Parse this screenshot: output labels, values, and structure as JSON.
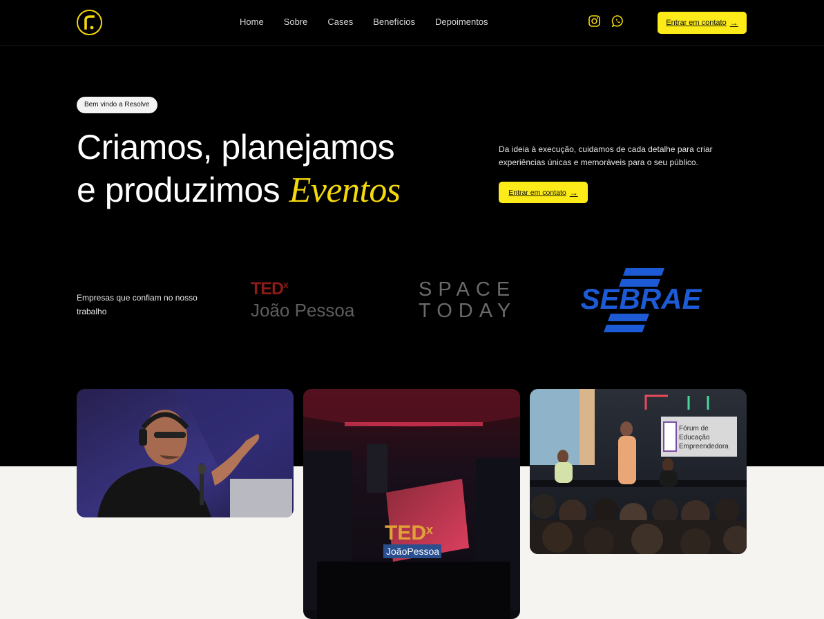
{
  "nav": {
    "items": [
      "Home",
      "Sobre",
      "Cases",
      "Benefícios",
      "Depoimentos"
    ]
  },
  "header": {
    "cta_label": "Entrar em contato",
    "social_icons": [
      "instagram-icon",
      "whatsapp-icon"
    ]
  },
  "hero": {
    "badge": "Bem vindo a Resolve",
    "title_line1": "Criamos, planejamos",
    "title_line2_start": "e produzimos",
    "title_accent": "Eventos",
    "description": "Da ideia à execução, cuidamos de cada detalhe para criar experiências únicas e memoráveis para o seu público.",
    "cta_label": "Entrar em contato"
  },
  "clients": {
    "label": "Empresas que confiam no nosso trabalho",
    "ted_top": "TED",
    "ted_sup": "x",
    "ted_city": "João Pessoa",
    "space_line1": "SPACE",
    "space_line2": "TODAY",
    "sebrae": "SEBRAE"
  },
  "photos": {
    "stage_sign_top": "TED",
    "stage_sign_sup": "x",
    "stage_sign_bottom": "JoãoPessoa",
    "forum_banner": [
      "Fórum de",
      "Educação",
      "Empreendedora"
    ]
  },
  "colors": {
    "accent": "#f5d90a",
    "button": "#fdeb19",
    "background_dark": "#000000",
    "background_light": "#f6f4f1",
    "sebrae_blue": "#1d5bd6"
  }
}
